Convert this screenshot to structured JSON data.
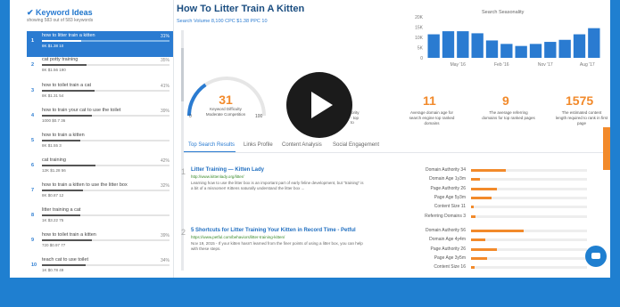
{
  "left_panel": {
    "title_prefix": "✔ Keyword",
    "title_ideas": "Ideas",
    "subtitle": "showing 583 out of 583 keywords",
    "items": [
      {
        "num": "1",
        "text": "how to litter train a kitten",
        "pct": "31%",
        "fill": 0.31,
        "meta": "8K   $1.38   10"
      },
      {
        "num": "2",
        "text": "cat potty training",
        "pct": "35%",
        "fill": 0.35,
        "meta": "8K   $1.56   190"
      },
      {
        "num": "3",
        "text": "how to toilet train a cat",
        "pct": "41%",
        "fill": 0.41,
        "meta": "8K   $1.31   54"
      },
      {
        "num": "4",
        "text": "how to train your cat to use the toilet",
        "pct": "39%",
        "fill": 0.39,
        "meta": "1000   $0.7   36"
      },
      {
        "num": "5",
        "text": "how to train a kitten",
        "pct": "",
        "fill": 0.3,
        "meta": "8K   $1.55   3"
      },
      {
        "num": "6",
        "text": "cat training",
        "pct": "42%",
        "fill": 0.42,
        "meta": "12K   $1.28   56"
      },
      {
        "num": "7",
        "text": "how to train a kitten to use the litter box",
        "pct": "32%",
        "fill": 0.32,
        "meta": "8K   $0.87   12"
      },
      {
        "num": "8",
        "text": "litter training a cat",
        "pct": "",
        "fill": 0.3,
        "meta": "1K   $3.22   75"
      },
      {
        "num": "9",
        "text": "how to toilet train a kitten",
        "pct": "39%",
        "fill": 0.39,
        "meta": "720   $0.97   77"
      },
      {
        "num": "10",
        "text": "teach cat to use toilet",
        "pct": "34%",
        "fill": 0.34,
        "meta": "1K   $0.78   49"
      }
    ]
  },
  "header": {
    "title": "How To Litter Train A Kitten",
    "sub": "Search Volume 8,100    CPC $1.38    PPC 10"
  },
  "seasonality": {
    "label": "Search Seasonality",
    "y_ticks": [
      "20K",
      "15K",
      "10K",
      "5K",
      "0"
    ],
    "x_labels": [
      "May '16",
      "Feb '16",
      "Nov '17",
      "Aug '17"
    ]
  },
  "chart_data": {
    "type": "bar",
    "title": "Search Seasonality",
    "categories": [
      "1",
      "2",
      "3",
      "4",
      "5",
      "6",
      "7",
      "8",
      "9",
      "10",
      "11",
      "12"
    ],
    "values": [
      11500,
      13000,
      13000,
      12000,
      8500,
      6800,
      5800,
      6800,
      7800,
      8800,
      11500,
      14500
    ],
    "ylim": [
      0,
      20000
    ],
    "x_tick_labels": [
      "May '16",
      "Feb '16",
      "Nov '17",
      "Aug '17"
    ],
    "color": "#2a7bd1"
  },
  "gauge": {
    "value": "31",
    "fill": 0.31,
    "label_line1": "Keyword Difficulty",
    "label_line2": "Moderate Competition",
    "min": "0",
    "max": "100"
  },
  "partial_text": "iority\n- top\nto",
  "stats": [
    {
      "value": "11",
      "unit": "",
      "label": "Average domain age for\nsearch engine top ranked\ndomains"
    },
    {
      "value": "9",
      "unit": "",
      "label": "The average referring\ndomains for top ranked pages"
    },
    {
      "value": "1575",
      "unit": "",
      "label": "The estimated content\nlength required to rank in first\npage"
    }
  ],
  "tabs": [
    "Top Search Results",
    "Links Profile",
    "Content Analysis",
    "Social Engagement"
  ],
  "results": [
    {
      "index": "1",
      "title": "Litter Training — Kitten Lady",
      "url": "http://www.kittenlady.org/litter/",
      "desc": "Learning how to use the litter box is an important part of early feline development, but \"training\" is a bit of a misnomer! Kittens naturally understand the litter box ...",
      "metrics": [
        {
          "label": "Domain Authority 34",
          "fill": 0.3
        },
        {
          "label": "Domain Age 1y3m",
          "fill": 0.08
        },
        {
          "label": "Page Authority 26",
          "fill": 0.22
        },
        {
          "label": "Page Age 5y3m",
          "fill": 0.18
        },
        {
          "label": "Content Size 11",
          "fill": 0.02
        },
        {
          "label": "Referring Domains 3",
          "fill": 0.04
        }
      ]
    },
    {
      "index": "2",
      "title": "5 Shortcuts for Litter Training Your Kitten in Record Time - Petful",
      "url": "https://www.petful.com/behaviors/litter-training-kitten/",
      "desc": "Nov 19, 2015 - If your kitten hasn't learned from the finer points of using a litter box, you can help with these steps.",
      "metrics": [
        {
          "label": "Domain Authority 56",
          "fill": 0.45
        },
        {
          "label": "Domain Age 4y4m",
          "fill": 0.12
        },
        {
          "label": "Page Authority 26",
          "fill": 0.22
        },
        {
          "label": "Page Age 3y5m",
          "fill": 0.14
        },
        {
          "label": "Content Size 16",
          "fill": 0.03
        }
      ]
    }
  ],
  "feedback_label": "Feedback",
  "colors": {
    "accent": "#2a7bd1",
    "orange": "#f28a2b",
    "frame_bg": "#1f7fd0"
  }
}
